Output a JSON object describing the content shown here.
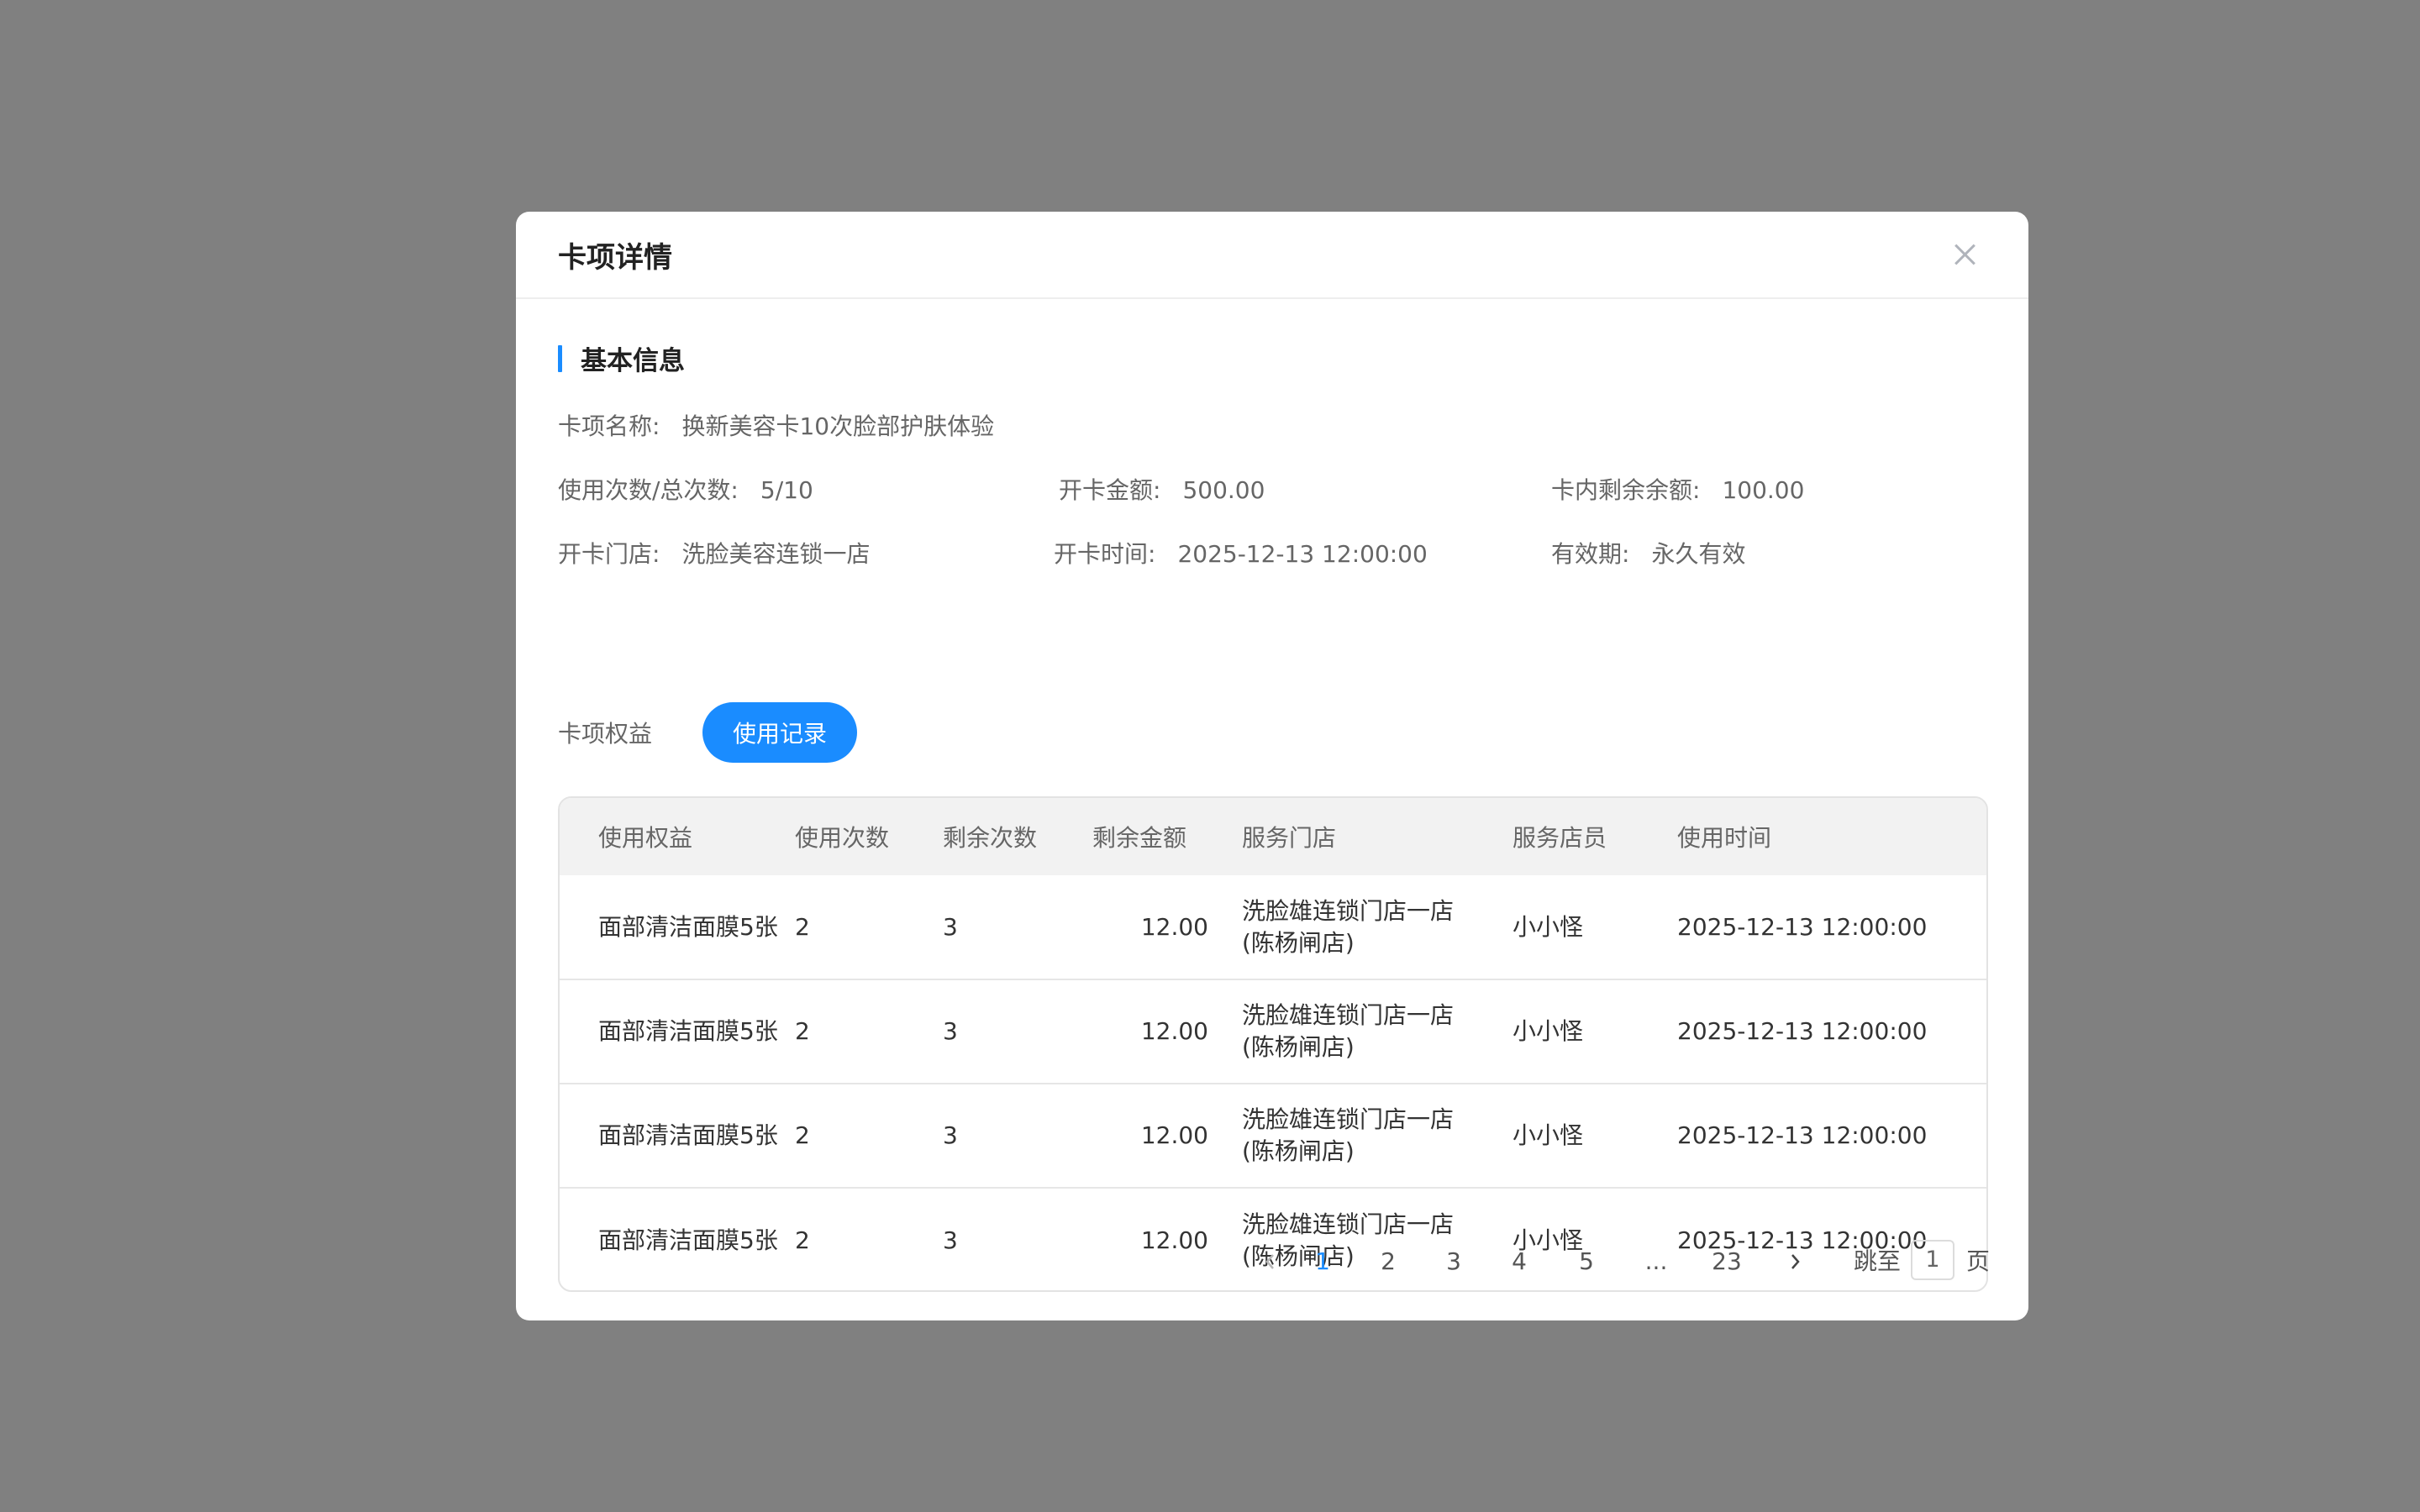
{
  "modal": {
    "title": "卡项详情"
  },
  "basic_info": {
    "section_title": "基本信息",
    "card_name": {
      "label": "卡项名称:",
      "value": "换新美容卡10次脸部护肤体验"
    },
    "usage": {
      "label": "使用次数/总次数:",
      "value": "5/10"
    },
    "open_amount": {
      "label": "开卡金额:",
      "value": "500.00"
    },
    "remaining_amount": {
      "label": "卡内剩余余额:",
      "value": "100.00"
    },
    "open_store": {
      "label": "开卡门店:",
      "value": "洗脸美容连锁一店"
    },
    "open_time": {
      "label": "开卡时间:",
      "value": "2025-12-13 12:00:00"
    },
    "validity": {
      "label": "有效期:",
      "value": "永久有效"
    }
  },
  "tabs": {
    "rights": "卡项权益",
    "records": "使用记录",
    "active": "使用记录"
  },
  "table": {
    "columns": [
      "使用权益",
      "使用次数",
      "剩余次数",
      "剩余金额",
      "服务门店",
      "服务店员",
      "使用时间"
    ],
    "rows": [
      {
        "right": "面部清洁面膜5张",
        "used": "2",
        "remain": "3",
        "amount": "12.00",
        "store_line1": "洗脸雄连锁门店一店",
        "store_line2": "(陈杨闸店)",
        "staff": "小小怪",
        "time": "2025-12-13 12:00:00"
      },
      {
        "right": "面部清洁面膜5张",
        "used": "2",
        "remain": "3",
        "amount": "12.00",
        "store_line1": "洗脸雄连锁门店一店",
        "store_line2": "(陈杨闸店)",
        "staff": "小小怪",
        "time": "2025-12-13 12:00:00"
      },
      {
        "right": "面部清洁面膜5张",
        "used": "2",
        "remain": "3",
        "amount": "12.00",
        "store_line1": "洗脸雄连锁门店一店",
        "store_line2": "(陈杨闸店)",
        "staff": "小小怪",
        "time": "2025-12-13 12:00:00"
      },
      {
        "right": "面部清洁面膜5张",
        "used": "2",
        "remain": "3",
        "amount": "12.00",
        "store_line1": "洗脸雄连锁门店一店",
        "store_line2": "(陈杨闸店)",
        "staff": "小小怪",
        "time": "2025-12-13 12:00:00"
      }
    ]
  },
  "pagination": {
    "pages": [
      "1",
      "2",
      "3",
      "4",
      "5",
      "...",
      "23"
    ],
    "current": "1",
    "jump_prefix": "跳至",
    "jump_value": "1",
    "jump_suffix": "页"
  },
  "colors": {
    "accent": "#1a8cff",
    "overlay": "#808080"
  }
}
